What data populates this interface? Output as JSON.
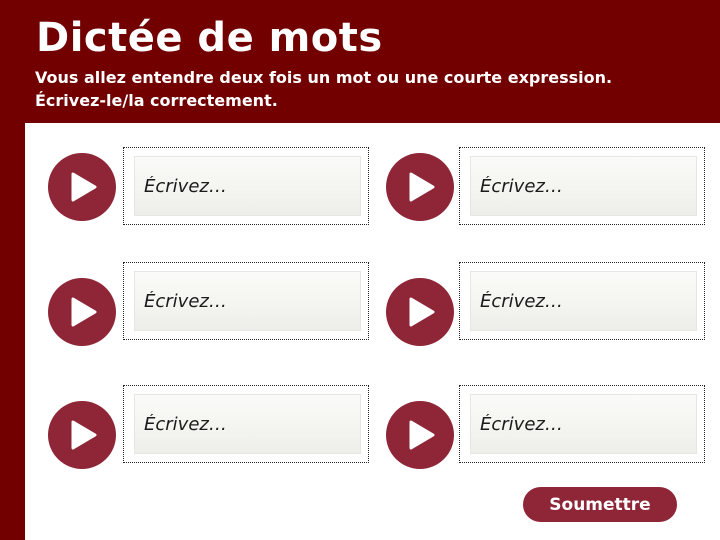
{
  "header": {
    "title": "Dictée de mots",
    "instructions_line1": "Vous allez entendre deux fois un mot ou une courte expression.",
    "instructions_line2": "Écrivez-le/la correctement."
  },
  "items": [
    {
      "placeholder": "Écrivez…",
      "value": ""
    },
    {
      "placeholder": "Écrivez…",
      "value": ""
    },
    {
      "placeholder": "Écrivez…",
      "value": ""
    },
    {
      "placeholder": "Écrivez…",
      "value": ""
    },
    {
      "placeholder": "Écrivez…",
      "value": ""
    },
    {
      "placeholder": "Écrivez…",
      "value": ""
    }
  ],
  "icons": {
    "play": "play-icon"
  },
  "submit_label": "Soumettre",
  "colors": {
    "header_bg": "#720000",
    "accent": "#8e2637",
    "panel_bg": "#ffffff"
  }
}
